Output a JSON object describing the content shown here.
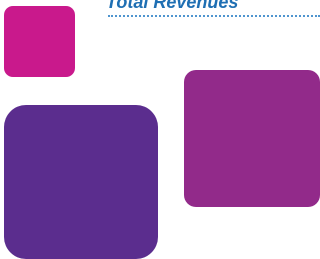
{
  "header": {
    "title": "Total Revenues"
  },
  "colors": {
    "title_text": "#1f6fb3",
    "rule": "#4f95cf",
    "magenta_tile": "#c9198c",
    "plum_tile": "#922a8a",
    "indigo_tile": "#5b2d8e"
  },
  "tiles": [
    {
      "name": "magenta-square",
      "color_key": "magenta_tile"
    },
    {
      "name": "plum-square",
      "color_key": "plum_tile"
    },
    {
      "name": "indigo-square",
      "color_key": "indigo_tile"
    }
  ]
}
